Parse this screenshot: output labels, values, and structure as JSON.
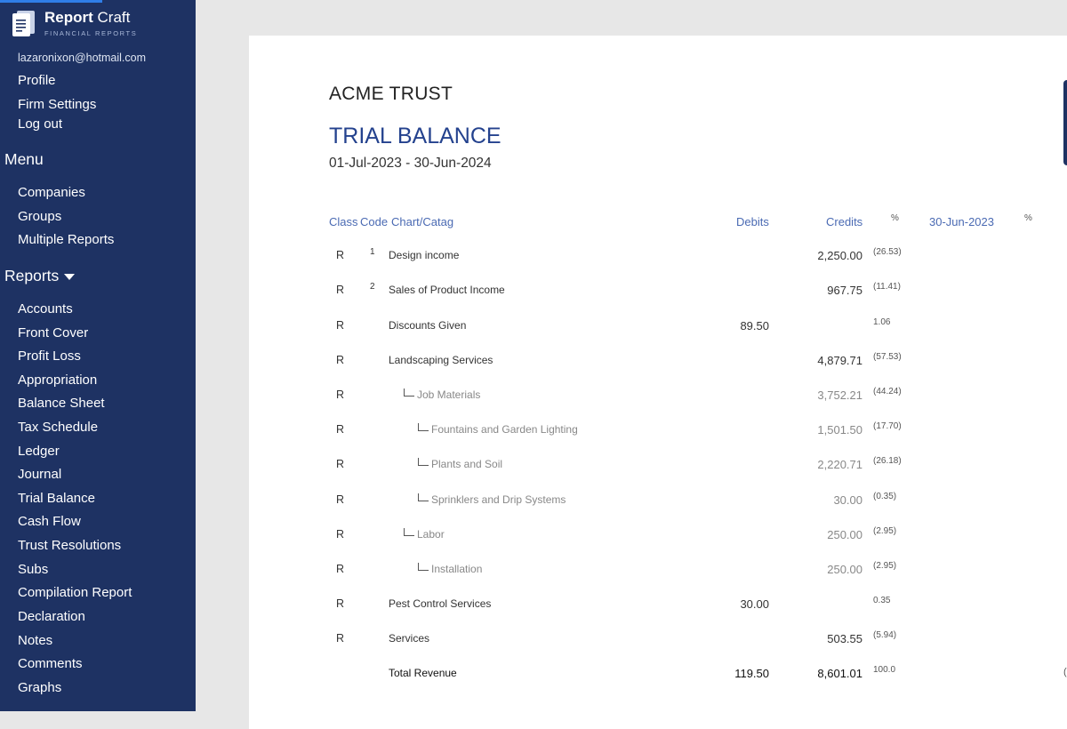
{
  "brand": {
    "name_bold": "Report",
    "name_light": "Craft",
    "tagline": "FINANCIAL REPORTS"
  },
  "user": {
    "email": "lazaronixon@hotmail.com",
    "links": [
      "Profile",
      "Firm Settings",
      "Log out"
    ]
  },
  "menu": {
    "title": "Menu",
    "items": [
      "Companies",
      "Groups",
      "Multiple Reports"
    ]
  },
  "reports": {
    "title": "Reports",
    "items": [
      "Accounts",
      "Front Cover",
      "Profit Loss",
      "Appropriation",
      "Balance Sheet",
      "Tax Schedule",
      "Ledger",
      "Journal",
      "Trial Balance",
      "Cash Flow",
      "Trust Resolutions",
      "Subs",
      "Compilation Report",
      "Declaration",
      "Notes",
      "Comments",
      "Graphs"
    ]
  },
  "report": {
    "company": "ACME TRUST",
    "title": "TRIAL BALANCE",
    "period": "01-Jul-2023 - 30-Jun-2024",
    "columns": {
      "class": "Class",
      "code": "Code",
      "chart": "Chart/Catag",
      "debits": "Debits",
      "credits": "Credits",
      "pct": "%",
      "prior": "30-Jun-2023",
      "prior_pct": "%"
    },
    "rows": [
      {
        "class": "R",
        "code": "1",
        "desc": "Design income",
        "debit": "",
        "credit": "2,250.00",
        "pct": "(26.53)",
        "level": 0
      },
      {
        "class": "R",
        "code": "2",
        "desc": "Sales of Product Income",
        "debit": "",
        "credit": "967.75",
        "pct": "(11.41)",
        "level": 0
      },
      {
        "class": "R",
        "code": "",
        "desc": "Discounts Given",
        "debit": "89.50",
        "credit": "",
        "pct": "1.06",
        "level": 0
      },
      {
        "class": "R",
        "code": "",
        "desc": "Landscaping Services",
        "debit": "",
        "credit": "4,879.71",
        "pct": "(57.53)",
        "level": 0
      },
      {
        "class": "R",
        "code": "",
        "desc": "Job Materials",
        "debit": "",
        "credit": "3,752.21",
        "pct": "(44.24)",
        "level": 1
      },
      {
        "class": "R",
        "code": "",
        "desc": "Fountains and Garden Lighting",
        "debit": "",
        "credit": "1,501.50",
        "pct": "(17.70)",
        "level": 2
      },
      {
        "class": "R",
        "code": "",
        "desc": "Plants and Soil",
        "debit": "",
        "credit": "2,220.71",
        "pct": "(26.18)",
        "level": 2
      },
      {
        "class": "R",
        "code": "",
        "desc": "Sprinklers and Drip Systems",
        "debit": "",
        "credit": "30.00",
        "pct": "(0.35)",
        "level": 2
      },
      {
        "class": "R",
        "code": "",
        "desc": "Labor",
        "debit": "",
        "credit": "250.00",
        "pct": "(2.95)",
        "level": 1
      },
      {
        "class": "R",
        "code": "",
        "desc": "Installation",
        "debit": "",
        "credit": "250.00",
        "pct": "(2.95)",
        "level": 2
      },
      {
        "class": "R",
        "code": "",
        "desc": "Pest Control Services",
        "debit": "30.00",
        "credit": "",
        "pct": "0.35",
        "level": 0
      },
      {
        "class": "R",
        "code": "",
        "desc": "Services",
        "debit": "",
        "credit": "503.55",
        "pct": "(5.94)",
        "level": 0
      }
    ],
    "total": {
      "desc": "Total Revenue",
      "debit": "119.50",
      "credit": "8,601.01",
      "pct": "100.0",
      "edge": "("
    }
  },
  "colors": {
    "sidebar": "#1e3263",
    "accent": "#2f7ee8",
    "title": "#24428e",
    "header": "#4a6ab3"
  },
  "icons": {
    "logo": "document-icon",
    "reports_toggle": "caret-down-icon",
    "tree_branch": "tree-branch-icon"
  }
}
